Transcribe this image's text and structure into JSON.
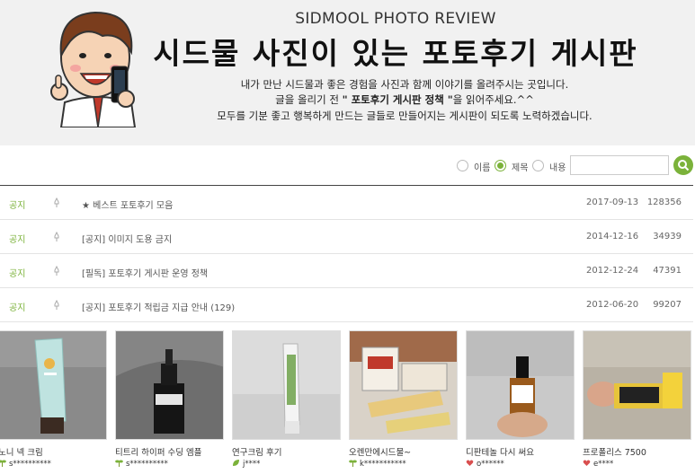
{
  "banner": {
    "english_title": "SIDMOOL PHOTO REVIEW",
    "title": "시드물 사진이 있는 포토후기 게시판",
    "line1": "내가 만난 시드물과 좋은 경험을 사진과 함께 이야기를 올려주시는 곳입니다.",
    "line2_prefix": "글을 올리기 전 ",
    "line2_bold": "\" 포토후기 게시판 정책 \"",
    "line2_suffix": "을 읽어주세요.^^",
    "line3": "모두를 기분 좋고 행복하게 만드는 글들로 만들어지는 게시판이 되도록 노력하겠습니다."
  },
  "search": {
    "options": [
      {
        "label": "이름",
        "selected": false
      },
      {
        "label": "제목",
        "selected": true
      },
      {
        "label": "내용",
        "selected": false
      }
    ],
    "input_value": "",
    "accent_color": "#7bb23a"
  },
  "notices": [
    {
      "badge": "공지",
      "title": "★ 베스트 포토후기 모음",
      "date": "2017-09-13",
      "views": "128356"
    },
    {
      "badge": "공지",
      "title": "[공지] 이미지 도용 금지",
      "date": "2014-12-16",
      "views": "34939"
    },
    {
      "badge": "공지",
      "title": "[필독] 포토후기 게시판 운영 정책",
      "date": "2012-12-24",
      "views": "47391"
    },
    {
      "badge": "공지",
      "title": "[공지] 포토후기 적립금 지급 안내 (129)",
      "date": "2012-06-20",
      "views": "99207"
    }
  ],
  "gallery": [
    {
      "title": "노니 넥 크림",
      "author": "s**********",
      "icon": "sprout-icon"
    },
    {
      "title": "티트리 하이퍼 수딩 엠플",
      "author": "s**********",
      "icon": "sprout-icon"
    },
    {
      "title": "연구크림 후기",
      "author": "j****",
      "icon": "leaf-icon"
    },
    {
      "title": "오렌만에시드물~",
      "author": "k***********",
      "icon": "sprout-icon"
    },
    {
      "title": "디판테놀 다시 써요",
      "author": "o******",
      "icon": "heart-icon"
    },
    {
      "title": "프로폴리스 7500",
      "author": "e****",
      "icon": "heart-icon"
    }
  ]
}
